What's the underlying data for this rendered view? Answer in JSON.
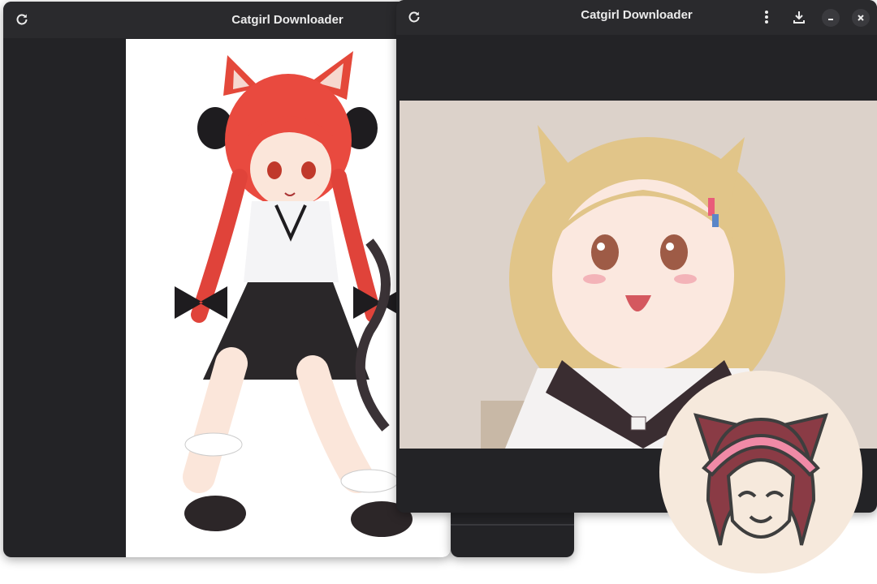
{
  "app": {
    "title": "Catgirl Downloader"
  },
  "windows": [
    {
      "title": "Catgirl Downloader",
      "buttons": [
        "refresh-icon"
      ]
    },
    {
      "title": "Catgirl Downloader",
      "buttons": [
        "refresh-icon",
        "menu-icon",
        "download-icon",
        "minimize-icon",
        "close-icon"
      ]
    }
  ],
  "images": [
    {
      "name": "red-haired catgirl illustration",
      "background": "#ffffff"
    },
    {
      "name": "blonde catgirl illustration",
      "background": "#d9cfc7"
    }
  ],
  "colors": {
    "window_bg": "#232326",
    "titlebar_bg": "#2a2a2d",
    "title_text": "#ececec",
    "app_icon_bg": "#f6e9dc",
    "app_icon_hair": "#8a3b45",
    "app_icon_headband": "#f08aa6"
  }
}
